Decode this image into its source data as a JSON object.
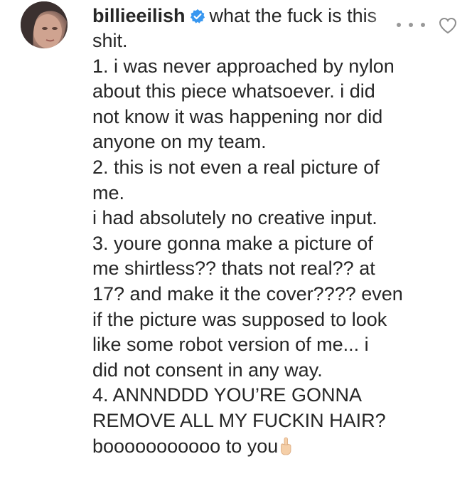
{
  "comment": {
    "username": "billieeilish",
    "verified_icon": "verified-badge-icon",
    "verified_color": "#3897f0",
    "first_line": "what the fuck is this",
    "more_icon": "more-options-icon",
    "like_icon": "heart-outline-icon",
    "lines": [
      "shit.",
      "1. i was never approached by nylon",
      "about this piece whatsoever. i did",
      "not know it was happening nor did",
      "anyone on my team.",
      "2. this is not even a real picture of",
      "me.",
      "i had absolutely no creative input.",
      "3. youre gonna make a picture of",
      "me shirtless?? thats not real?? at",
      "17? and make it the cover???? even",
      "if the picture was supposed to look",
      "like some robot version of me... i",
      "did not consent in any way.",
      "4. ANNNDDD YOU’RE GONNA",
      "REMOVE ALL MY FUCKIN HAIR?",
      "booooooooooo to you"
    ],
    "end_emoji": "middle-finger-emoji"
  }
}
